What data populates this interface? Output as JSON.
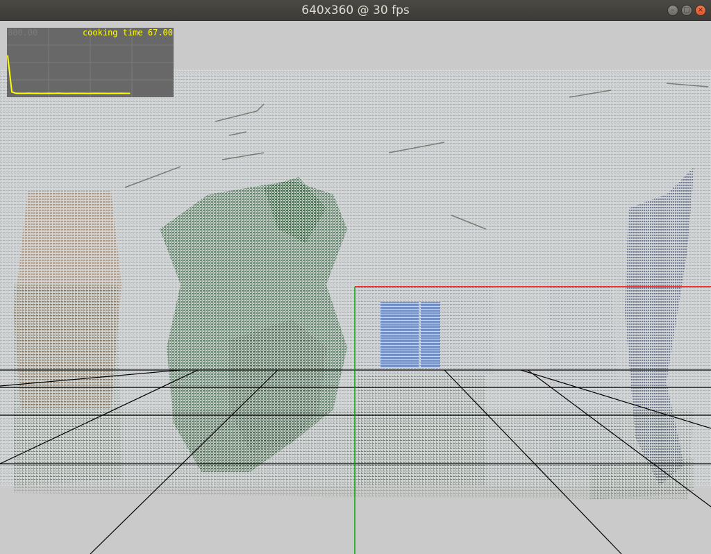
{
  "window": {
    "title": "640x360 @ 30 fps",
    "buttons": {
      "minimize": "minimize-icon",
      "maximize": "maximize-icon",
      "close": "close-icon"
    }
  },
  "hud": {
    "title": "cooking time 67.00",
    "max_label": "800.00",
    "line_color": "#ffff00"
  },
  "scene": {
    "x_axis_color": "#ff0000",
    "y_axis_color": "#00aa00",
    "grid_color": "#000000",
    "background": "#cacaca"
  },
  "chart_data": {
    "type": "line",
    "title": "cooking time 67.00",
    "ylim": [
      0,
      800
    ],
    "series": [
      {
        "values": [
          480,
          60,
          45,
          44,
          44,
          46,
          44,
          45,
          43,
          44,
          45,
          44,
          46,
          44,
          43,
          44,
          45,
          44,
          44,
          43,
          44,
          45,
          44,
          44,
          43,
          44,
          44,
          45,
          44,
          44
        ]
      }
    ]
  }
}
